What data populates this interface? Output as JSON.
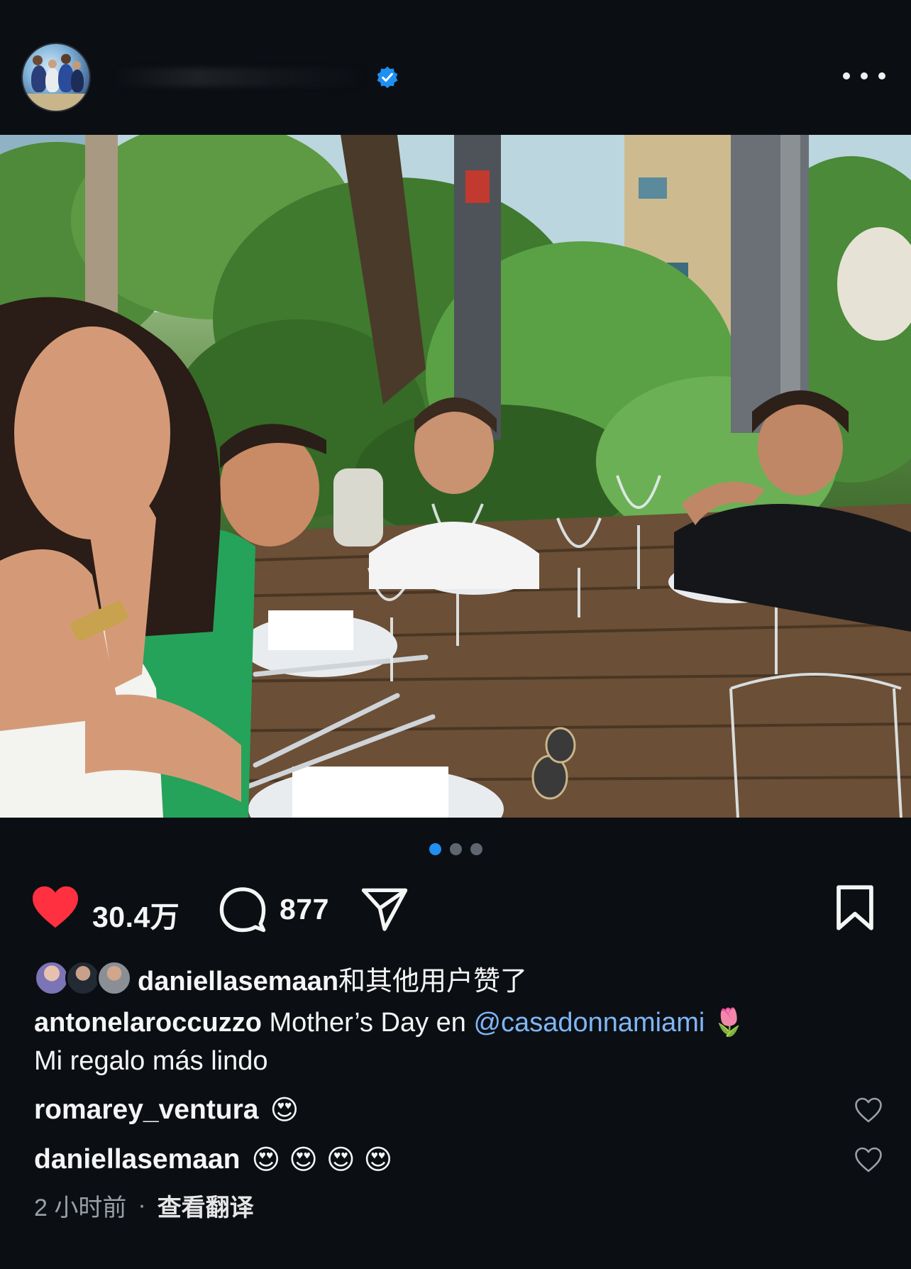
{
  "post": {
    "author_verified": true,
    "carousel": {
      "count": 3,
      "active": 1
    }
  },
  "actions": {
    "likes": "30.4万",
    "comments": "877"
  },
  "liked_by": {
    "user": "daniellasemaan",
    "rest": "和其他用户赞了"
  },
  "caption": {
    "user": "antonelaroccuzzo",
    "text_before": "Mother’s Day en",
    "mention": "@casadonnamiami",
    "emoji": "🌷",
    "line2": "Mi regalo más lindo"
  },
  "comments": [
    {
      "user": "romarey_ventura",
      "emojis": [
        "😍"
      ]
    },
    {
      "user": "daniellasemaan",
      "emojis": [
        "😍",
        "😍",
        "😍",
        "😍"
      ]
    }
  ],
  "meta": {
    "time": "2 小时前",
    "separator": "·",
    "translate": "查看翻译"
  },
  "colors": {
    "background": "#0b0f14",
    "like_red": "#ff3040",
    "mention_blue": "#7fb6f5",
    "verified_blue": "#1f8ff2",
    "dot_active": "#1f8ff2"
  },
  "icons": [
    "more-icon",
    "verified-badge-icon",
    "heart-filled-icon",
    "comment-icon",
    "share-icon",
    "bookmark-icon",
    "heart-outline-icon"
  ]
}
